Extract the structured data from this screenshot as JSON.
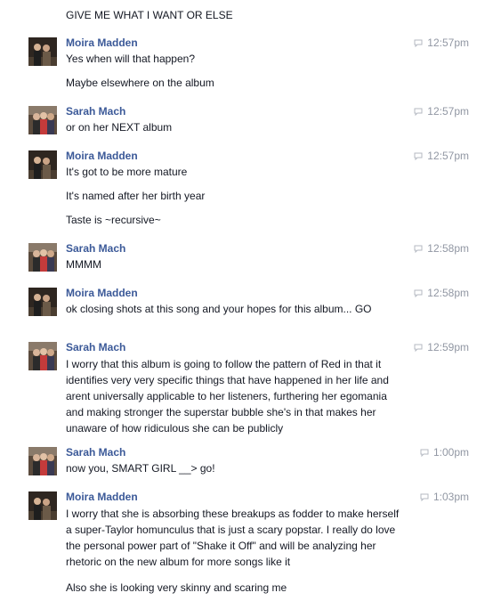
{
  "orphan_line": "GIVE ME WHAT I WANT OR ELSE",
  "messages": [
    {
      "sender": "Moira Madden",
      "time": "12:57pm",
      "paragraphs": [
        "Yes when will that happen?",
        "Maybe elsewhere on the album"
      ]
    },
    {
      "sender": "Sarah Mach",
      "time": "12:57pm",
      "paragraphs": [
        "or on her NEXT album"
      ]
    },
    {
      "sender": "Moira Madden",
      "time": "12:57pm",
      "paragraphs": [
        "It's got to be more mature",
        "It's named after her birth year",
        "Taste is ~recursive~"
      ]
    },
    {
      "sender": "Sarah Mach",
      "time": "12:58pm",
      "paragraphs": [
        "MMMM"
      ]
    },
    {
      "sender": "Moira Madden",
      "time": "12:58pm",
      "paragraphs": [
        "ok closing shots at this song and your hopes for this album... GO"
      ]
    },
    {
      "sender": "Sarah Mach",
      "time": "12:59pm",
      "paragraphs": [
        "I worry that this album is going to follow the pattern of Red in that it identifies very very specific things that have happened in her life and arent universally applicable to her listeners, furthering her egomania and making stronger the superstar bubble she's in that makes her unaware of how ridiculous she can be publicly"
      ]
    },
    {
      "sender": "Sarah Mach",
      "time": "1:00pm",
      "paragraphs": [
        "now you, SMART GIRL __> go!"
      ]
    },
    {
      "sender": "Moira Madden",
      "time": "1:03pm",
      "paragraphs": [
        "I worry that she is absorbing these breakups as fodder to make herself a super-Taylor homunculus that is just a  scary popstar. I really do love the personal power part of \"Shake it Off\" and will be analyzing her rhetoric on the new album for more songs like it",
        "Also she is looking very skinny and scaring me"
      ]
    }
  ],
  "icons": {
    "timestamp": "chat-bubble-icon",
    "avatar_moira": "moira-avatar",
    "avatar_sarah": "sarah-avatar"
  },
  "colors": {
    "sender_name": "#3b5998",
    "timestamp": "#9197a3",
    "text": "#141823"
  }
}
